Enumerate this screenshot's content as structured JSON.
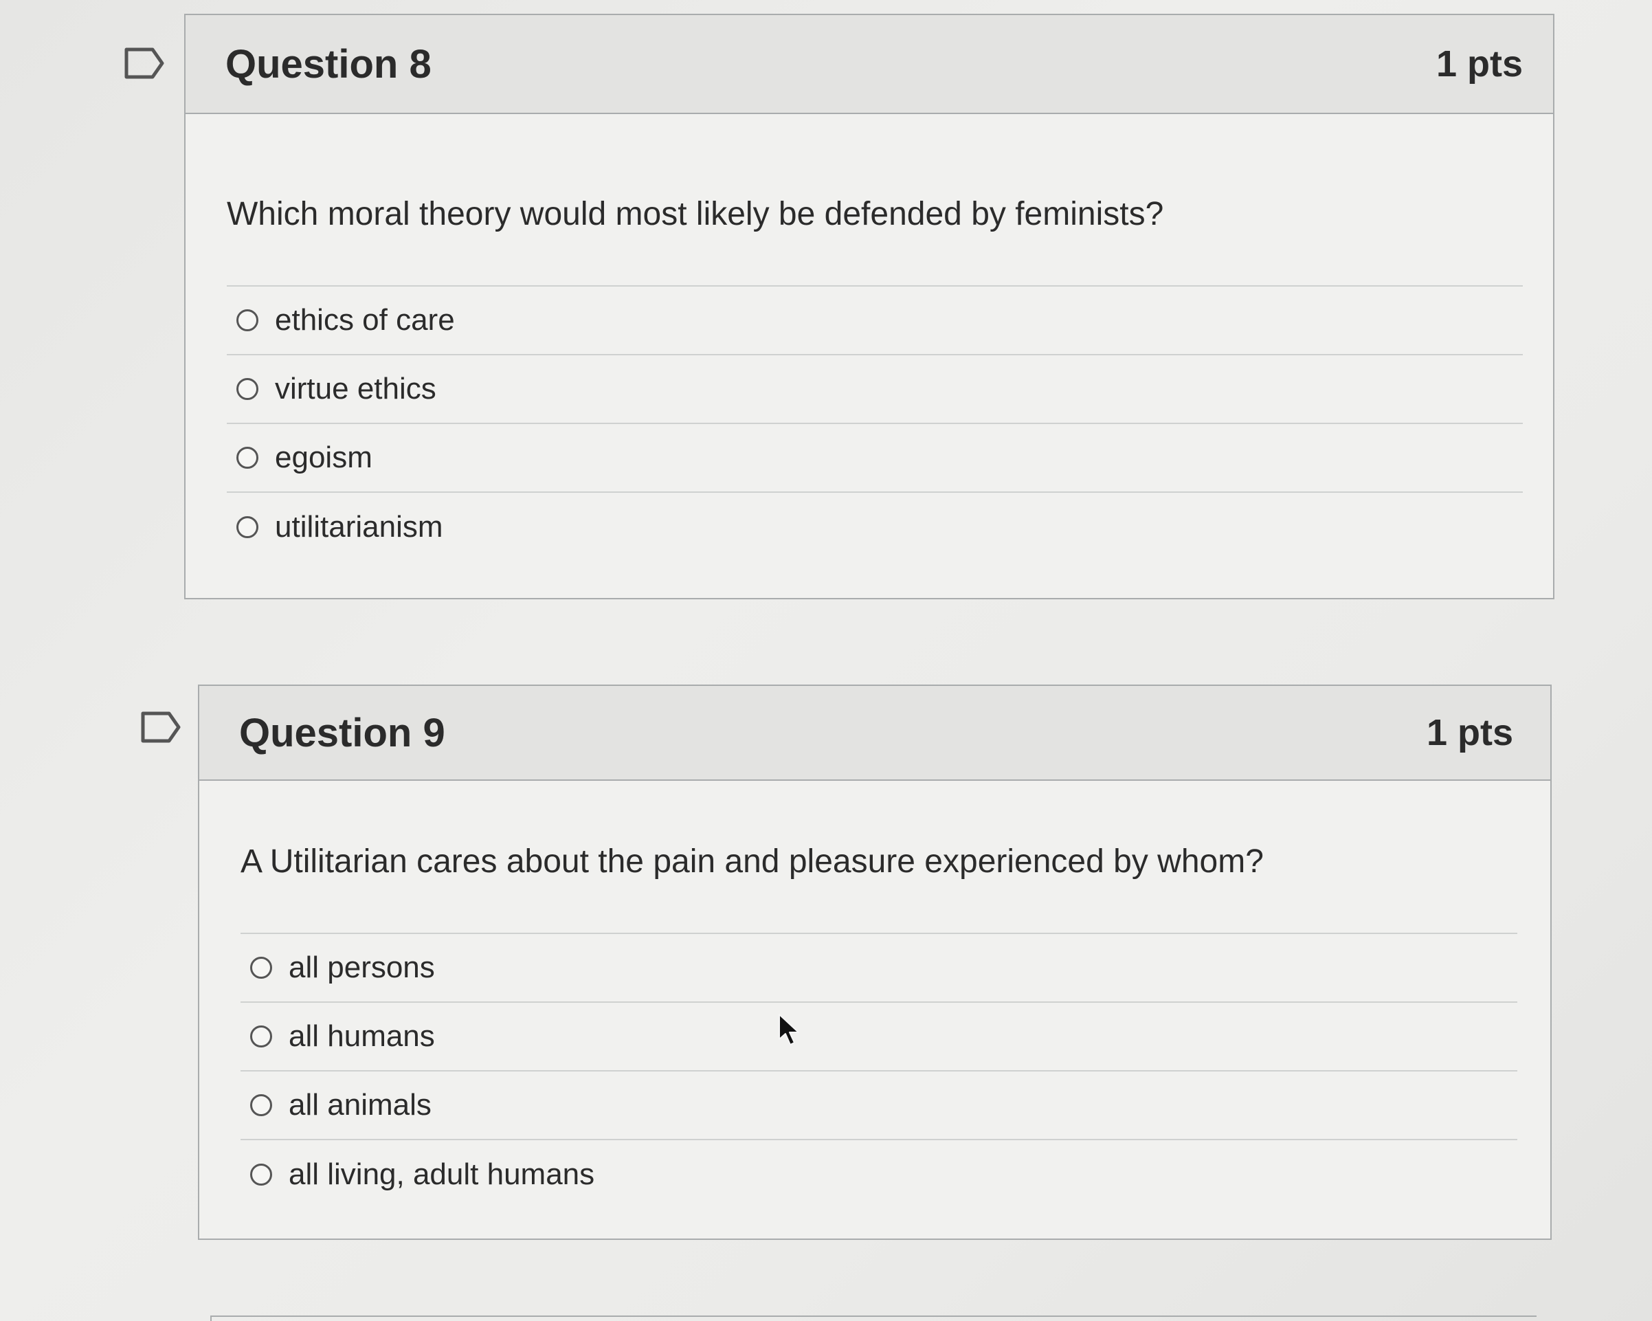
{
  "questions": [
    {
      "title": "Question 8",
      "points": "1 pts",
      "text": "Which moral theory would most likely be defended by feminists?",
      "answers": [
        "ethics of care",
        "virtue ethics",
        "egoism",
        "utilitarianism"
      ]
    },
    {
      "title": "Question 9",
      "points": "1 pts",
      "text": "A Utilitarian cares about the pain and pleasure experienced by whom?",
      "answers": [
        "all persons",
        "all humans",
        "all animals",
        "all living, adult humans"
      ]
    }
  ],
  "icons": {
    "flag": "flag-question-icon",
    "cursor": "mouse-pointer-icon",
    "radio": "radio-button-icon"
  },
  "colors": {
    "header_bg": "#e3e3e1",
    "body_bg": "#f1f1ef",
    "border": "#a9acad",
    "text": "#2b2b2b"
  }
}
